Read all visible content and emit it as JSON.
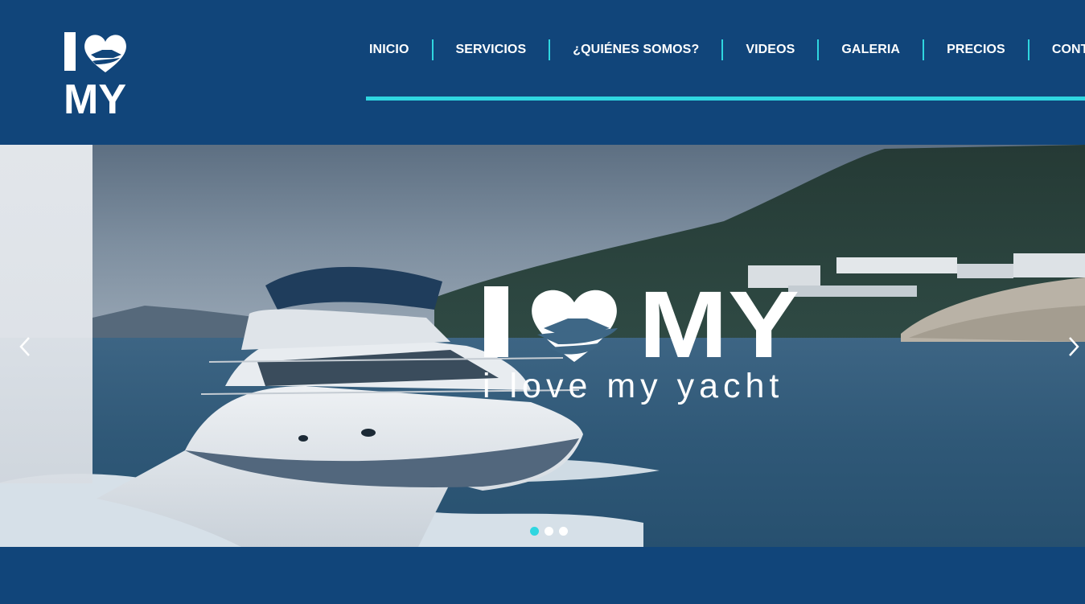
{
  "brand": {
    "logo_text_top": "I",
    "logo_text_bottom": "MY"
  },
  "nav": {
    "items": [
      {
        "label": "INICIO"
      },
      {
        "label": "SERVICIOS"
      },
      {
        "label": "¿QUIÉNES SOMOS?"
      },
      {
        "label": "VIDEOS"
      },
      {
        "label": "GALERIA"
      },
      {
        "label": "PRECIOS"
      },
      {
        "label": "CONTACTO"
      }
    ]
  },
  "hero": {
    "logo_i": "I",
    "logo_my": "MY",
    "tagline": "i love my yacht",
    "slides_total": 3,
    "active_slide": 1
  },
  "colors": {
    "brand_navy": "#11457a",
    "accent_cyan": "#2fd6e0",
    "white": "#ffffff"
  },
  "icons": [
    "chevron-left-icon",
    "chevron-right-icon",
    "heart-yacht-icon"
  ]
}
